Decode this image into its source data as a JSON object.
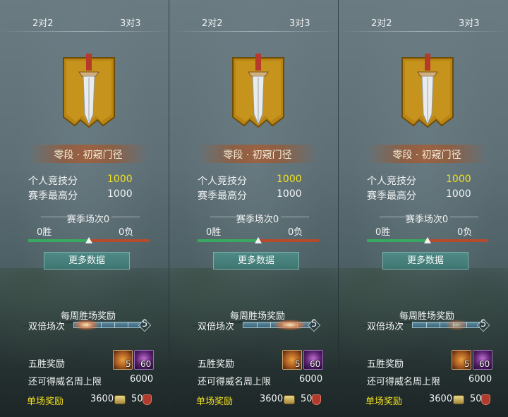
{
  "panels": [
    {
      "tabs": {
        "left": "2对2",
        "right": "3对3"
      },
      "rank": "零段 · 初窥门径",
      "stats": [
        {
          "label": "个人竞技分",
          "value": "1000"
        },
        {
          "label": "赛季最高分",
          "value": "1000"
        }
      ],
      "season": {
        "title": "赛季场次0",
        "wins": "0胜",
        "losses": "0负",
        "win_ratio": 0.5
      },
      "more_button": "更多数据",
      "weekly": {
        "title": "每周胜场奖励",
        "double_label": "双倍场次",
        "double_count": "5",
        "five_win_label": "五胜奖励",
        "item1_qty": "5",
        "item2_qty": "60",
        "cap_label": "还可得威名周上限",
        "cap_value": "6000",
        "single_label": "单场奖励",
        "single_value1": "3600",
        "single_value2": "50"
      }
    },
    {
      "tabs": {
        "left": "2对2",
        "right": "3对3"
      },
      "rank": "零段 · 初窥门径",
      "stats": [
        {
          "label": "个人竞技分",
          "value": "1000"
        },
        {
          "label": "赛季最高分",
          "value": "1000"
        }
      ],
      "season": {
        "title": "赛季场次0",
        "wins": "0胜",
        "losses": "0负",
        "win_ratio": 0.5
      },
      "more_button": "更多数据",
      "weekly": {
        "title": "每周胜场奖励",
        "double_label": "双倍场次",
        "double_count": "5",
        "five_win_label": "五胜奖励",
        "item1_qty": "5",
        "item2_qty": "60",
        "cap_label": "还可得威名周上限",
        "cap_value": "6000",
        "single_label": "单场奖励",
        "single_value1": "3600",
        "single_value2": "50"
      }
    },
    {
      "tabs": {
        "left": "2对2",
        "right": "3对3"
      },
      "rank": "零段 · 初窥门径",
      "stats": [
        {
          "label": "个人竞技分",
          "value": "1000"
        },
        {
          "label": "赛季最高分",
          "value": "1000"
        }
      ],
      "season": {
        "title": "赛季场次0",
        "wins": "0胜",
        "losses": "0负",
        "win_ratio": 0.5
      },
      "more_button": "更多数据",
      "weekly": {
        "title": "每周胜场奖励",
        "double_label": "双倍场次",
        "double_count": "5",
        "five_win_label": "五胜奖励",
        "item1_qty": "5",
        "item2_qty": "60",
        "cap_label": "还可得威名周上限",
        "cap_value": "6000",
        "single_label": "单场奖励",
        "single_value1": "3600",
        "single_value2": "50"
      }
    }
  ],
  "colors": {
    "gold_text": "#f2e020",
    "win_bar": "#3aa860",
    "loss_bar": "#b44b2c",
    "button": "#4f8a86"
  },
  "icons": {
    "emblem": "sword-banner-icon",
    "item1": "treasure-chest-icon",
    "item2": "gem-icon",
    "currency1": "coin-icon",
    "currency2": "shield-icon"
  }
}
